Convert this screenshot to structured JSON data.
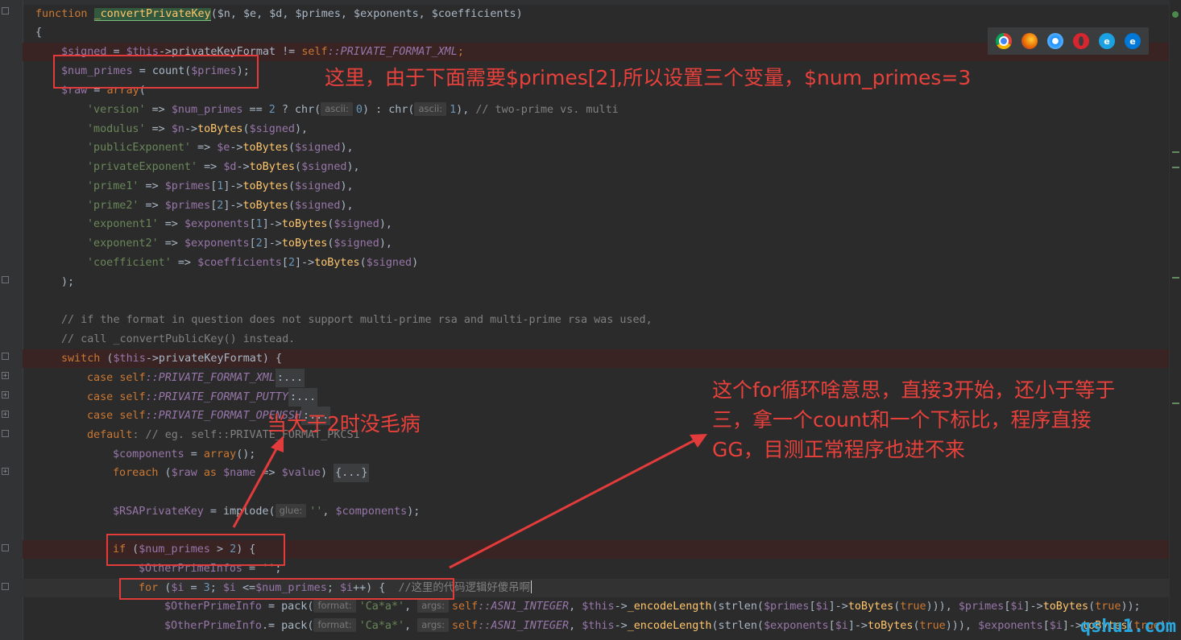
{
  "code_lines": {
    "l1_kw": "function",
    "l1_name": "_convertPrivateKey",
    "l1_params": "($n, $e, $d, $primes, $exponents, $coefficients)",
    "l2": "{",
    "l3_var": "$signed",
    "l3_eq": " = ",
    "l3_this": "$this",
    "l3_prop": "->privateKeyFormat != ",
    "l3_self": "self",
    "l3_const": "::PRIVATE_FORMAT_XML",
    "l3_end": ";",
    "l4_var": "$num_primes",
    "l4_mid": " = count(",
    "l4_arg": "$primes",
    "l4_end": ");",
    "l5_var": "$raw",
    "l5_mid": " = ",
    "l5_kw": "array",
    "l5_end": "(",
    "l6_key": "'version'",
    "l6_mid": " => ",
    "l6_var": "$num_primes",
    "l6_cmp": " == ",
    "l6_n": "2",
    "l6_q": " ? chr(",
    "l6_hint": "ascii:",
    "l6_a": "0",
    "l6_c": ") : chr(",
    "l6_hint2": "ascii:",
    "l6_b": "1",
    "l6_d": "), ",
    "l6_cmt": "// two-prime vs. multi",
    "l7_key": "'modulus'",
    "l7_var": "$n",
    "l7_call": "toBytes",
    "l7_arg": "$signed",
    "l8_key": "'publicExponent'",
    "l8_var": "$e",
    "l9_key": "'privateExponent'",
    "l9_var": "$d",
    "l10_key": "'prime1'",
    "l10_var": "$primes",
    "l10_idx": "1",
    "l11_key": "'prime2'",
    "l11_var": "$primes",
    "l11_idx": "2",
    "l12_key": "'exponent1'",
    "l12_var": "$exponents",
    "l12_idx": "1",
    "l13_key": "'exponent2'",
    "l13_var": "$exponents",
    "l13_idx": "2",
    "l14_key": "'coefficient'",
    "l14_var": "$coefficients",
    "l14_idx": "2",
    "l15": ");",
    "l17_cmt": "// if the format in question does not support multi-prime rsa and multi-prime rsa was used,",
    "l18_cmt": "// call _convertPublicKey() instead.",
    "l19_kw": "switch",
    "l19_var": "$this",
    "l19_mid": "->privateKeyFormat) {",
    "l20_kw": "case",
    "l20_self": "self",
    "l20_const": "::PRIVATE_FORMAT_XML",
    "l21_const": "::PRIVATE_FORMAT_PUTTY",
    "l22_const": "::PRIVATE_FORMAT_OPENSSH",
    "fold_dots": ":...",
    "l23_kw": "default",
    "l23_cmt": ": // eg. self::PRIVATE_FORMAT_PKCS1",
    "l24_var": "$components",
    "l24_kw": "array",
    "l24_end": "();",
    "l25_kw": "foreach",
    "l25_var1": "$raw",
    "l25_as": "as",
    "l25_var2": "$name",
    "l25_var3": "$value",
    "l25_end": "{...}",
    "l27_var": "$RSAPrivateKey",
    "l27_mid": " = implode(",
    "l27_hint": "glue:",
    "l27_str": "''",
    "l27_var2": "$components",
    "l29_kw": "if",
    "l29_var": "$num_primes",
    "l29_num": "2",
    "l30_var": "$OtherPrimeInfos",
    "l30_str": "''",
    "l31_kw": "for",
    "l31_var": "$i",
    "l31_num": "3",
    "l31_var2": "$num_primes",
    "l31_cmt": "//这里的代码逻辑好傻吊啊",
    "l32_var": "$OtherPrimeInfo",
    "l32_mid": " = pack(",
    "l32_hint1": "format:",
    "l32_str": "'Ca*a*'",
    "l32_hint2": "args:",
    "l32_self": "self",
    "l32_const": "::ASN1_INTEGER",
    "l32_this": "$this",
    "l32_fn": "_encodeLength",
    "l32_strlen": "(strlen(",
    "l32_arr": "$primes",
    "l32_idx": "$i",
    "l32_tb": "toBytes",
    "l32_true": "true",
    "l33_var": "$OtherPrimeInfo",
    "l33_mid": ".= pack(",
    "l33_arr": "$exponents"
  },
  "annotations": {
    "note1": "这里，由于下面需要$primes[2],所以设置三个变量，$num_primes=3",
    "note2": "当大于2时没毛病",
    "note3": "这个for循环啥意思，直接3开始，还小于等于\n三，拿一个count和一个下标比，程序直接\nGG，目测正常程序也进不来",
    "color": "#e8413c"
  },
  "browser_icons": [
    "chrome-icon",
    "firefox-icon",
    "safari-icon",
    "opera-icon",
    "ie-icon",
    "edge-icon"
  ],
  "watermark": "qshu1.com"
}
